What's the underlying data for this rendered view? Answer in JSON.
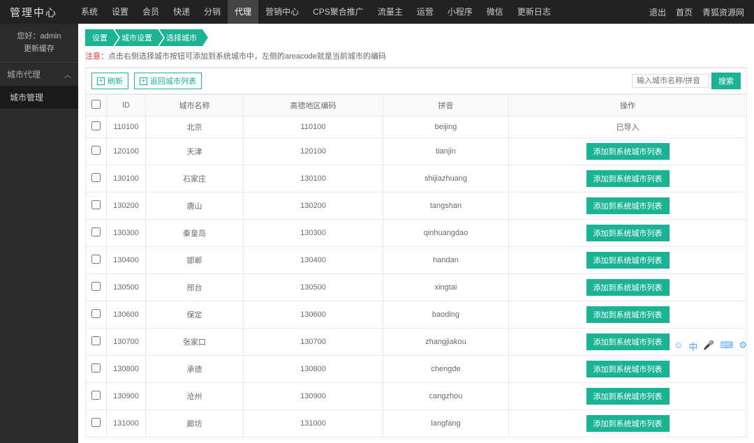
{
  "brand": "管理中心",
  "topnav": [
    "系统",
    "设置",
    "会员",
    "快递",
    "分销",
    "代理",
    "营销中心",
    "CPS聚合推广",
    "流量主",
    "运营",
    "小程序",
    "微信",
    "更新日志"
  ],
  "topnav_active": 5,
  "top_right": [
    "退出",
    "首页",
    "青狐资源网"
  ],
  "user": {
    "greet": "您好：admin",
    "cache": "更新缓存"
  },
  "sidebar": {
    "group": "城市代理",
    "items": [
      "城市管理"
    ]
  },
  "breadcrumbs": [
    "设置",
    "城市设置",
    "选择城市"
  ],
  "note_label": "注意：",
  "note_text": "点击右侧选择城市按钮可添加到系统城市中，左侧的areacode就是当前城市的编码",
  "toolbar": {
    "refresh": "刷新",
    "back": "返回城市列表"
  },
  "search": {
    "placeholder": "输入城市名称/拼音",
    "btn": "搜索"
  },
  "columns": {
    "id": "ID",
    "name": "城市名称",
    "code": "高德地区编码",
    "pinyin": "拼音",
    "op": "操作"
  },
  "op_add": "添加到系统城市列表",
  "op_done": "已导入",
  "rows": [
    {
      "id": "110100",
      "name": "北京",
      "code": "110100",
      "pinyin": "beijing",
      "done": true
    },
    {
      "id": "120100",
      "name": "天津",
      "code": "120100",
      "pinyin": "tianjin",
      "done": false
    },
    {
      "id": "130100",
      "name": "石家庄",
      "code": "130100",
      "pinyin": "shijiazhuang",
      "done": false
    },
    {
      "id": "130200",
      "name": "唐山",
      "code": "130200",
      "pinyin": "tangshan",
      "done": false
    },
    {
      "id": "130300",
      "name": "秦皇岛",
      "code": "130300",
      "pinyin": "qinhuangdao",
      "done": false
    },
    {
      "id": "130400",
      "name": "邯郸",
      "code": "130400",
      "pinyin": "handan",
      "done": false
    },
    {
      "id": "130500",
      "name": "邢台",
      "code": "130500",
      "pinyin": "xingtai",
      "done": false
    },
    {
      "id": "130600",
      "name": "保定",
      "code": "130600",
      "pinyin": "baoding",
      "done": false
    },
    {
      "id": "130700",
      "name": "张家口",
      "code": "130700",
      "pinyin": "zhangjiakou",
      "done": false
    },
    {
      "id": "130800",
      "name": "承德",
      "code": "130800",
      "pinyin": "chengde",
      "done": false
    },
    {
      "id": "130900",
      "name": "沧州",
      "code": "130900",
      "pinyin": "cangzhou",
      "done": false
    },
    {
      "id": "131000",
      "name": "廊坊",
      "code": "131000",
      "pinyin": "langfang",
      "done": false
    }
  ]
}
